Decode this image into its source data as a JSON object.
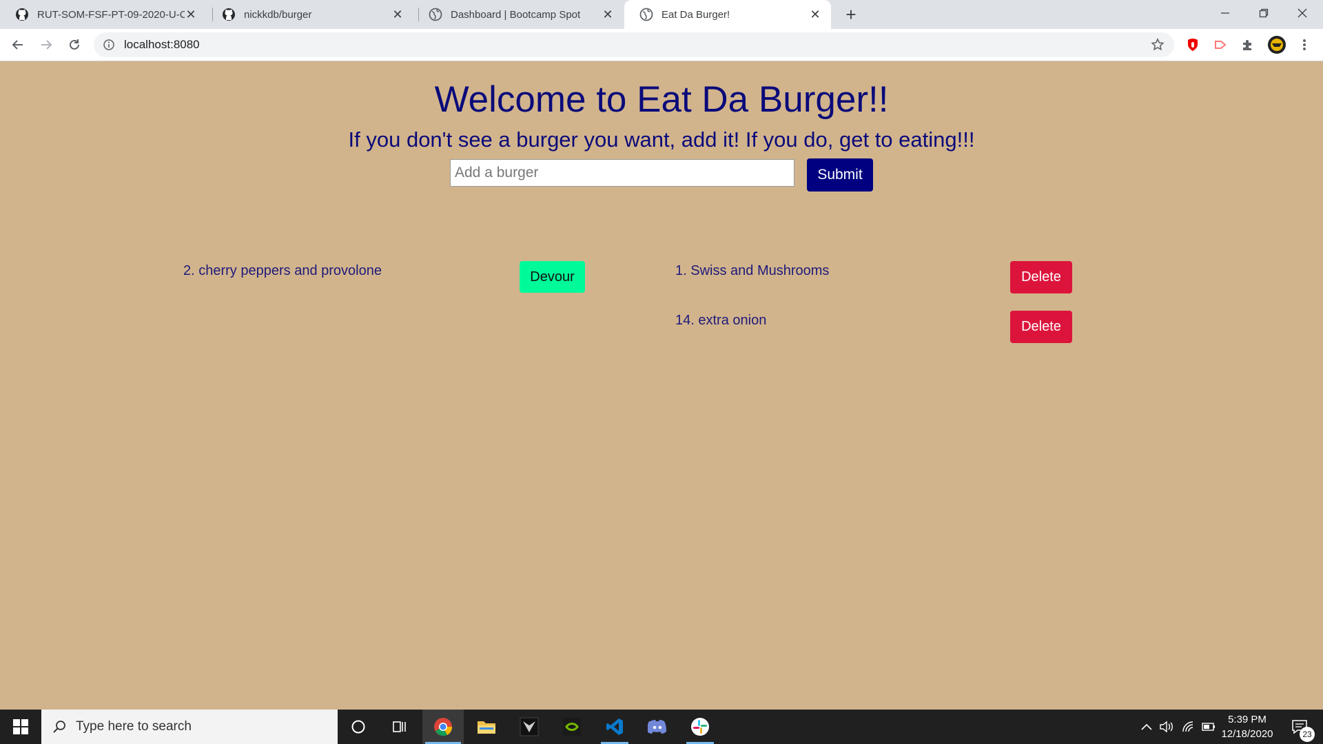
{
  "browser": {
    "tabs": [
      {
        "title": "RUT-SOM-FSF-PT-09-2020-U-C/",
        "icon": "github-icon",
        "active": false
      },
      {
        "title": "nickkdb/burger",
        "icon": "github-icon",
        "active": false
      },
      {
        "title": "Dashboard | Bootcamp Spot",
        "icon": "globe-icon",
        "active": false
      },
      {
        "title": "Eat Da Burger!",
        "icon": "globe-icon",
        "active": true
      }
    ],
    "close_glyph": "✕",
    "new_tab_glyph": "+",
    "url": "localhost:8080"
  },
  "page": {
    "heading": "Welcome to Eat Da Burger!!",
    "subheading": "If you don't see a burger you want, add it! If you do, get to eating!!!",
    "input_placeholder": "Add a burger",
    "submit_label": "Submit",
    "uneaten_burgers": [
      {
        "label": "2. cherry peppers and provolone",
        "button": "Devour"
      }
    ],
    "eaten_burgers": [
      {
        "label": "1. Swiss and Mushrooms",
        "button": "Delete"
      },
      {
        "label": "14. extra onion",
        "button": "Delete"
      }
    ]
  },
  "taskbar": {
    "search_placeholder": "Type here to search",
    "time": "5:39 PM",
    "date": "12/18/2020",
    "notification_count": "23"
  },
  "colors": {
    "page_background": "#d2b48c",
    "heading": "#0a0a7a",
    "submit": "#000080",
    "devour": "#00fa9a",
    "delete": "#dc143c"
  }
}
